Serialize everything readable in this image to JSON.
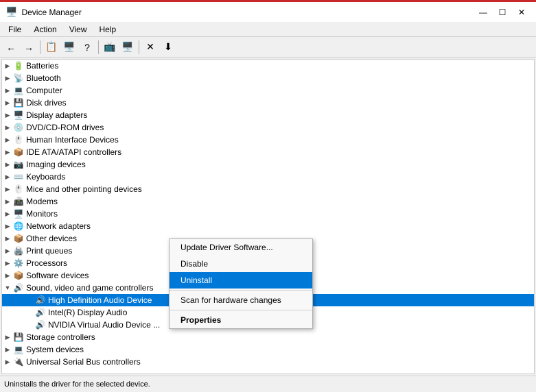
{
  "window": {
    "title": "Device Manager",
    "titleIcon": "🖥️"
  },
  "menu": {
    "items": [
      "File",
      "Action",
      "View",
      "Help"
    ]
  },
  "toolbar": {
    "buttons": [
      "←",
      "→",
      "📋",
      "🖥️",
      "?",
      "📺",
      "🖥️",
      "✕",
      "⬇"
    ]
  },
  "tree": {
    "items": [
      {
        "id": "batteries",
        "label": "Batteries",
        "indent": 1,
        "arrow": "▶",
        "icon": "🔋"
      },
      {
        "id": "bluetooth",
        "label": "Bluetooth",
        "indent": 1,
        "arrow": "▶",
        "icon": "📡"
      },
      {
        "id": "computer",
        "label": "Computer",
        "indent": 1,
        "arrow": "▶",
        "icon": "💻"
      },
      {
        "id": "diskdrives",
        "label": "Disk drives",
        "indent": 1,
        "arrow": "▶",
        "icon": "💾"
      },
      {
        "id": "displayadapters",
        "label": "Display adapters",
        "indent": 1,
        "arrow": "▶",
        "icon": "🖥️"
      },
      {
        "id": "dvdcdrom",
        "label": "DVD/CD-ROM drives",
        "indent": 1,
        "arrow": "▶",
        "icon": "💿"
      },
      {
        "id": "humaninterface",
        "label": "Human Interface Devices",
        "indent": 1,
        "arrow": "▶",
        "icon": "🖱️"
      },
      {
        "id": "ideata",
        "label": "IDE ATA/ATAPI controllers",
        "indent": 1,
        "arrow": "▶",
        "icon": "📦"
      },
      {
        "id": "imaging",
        "label": "Imaging devices",
        "indent": 1,
        "arrow": "▶",
        "icon": "📷"
      },
      {
        "id": "keyboards",
        "label": "Keyboards",
        "indent": 1,
        "arrow": "▶",
        "icon": "⌨️"
      },
      {
        "id": "mice",
        "label": "Mice and other pointing devices",
        "indent": 1,
        "arrow": "▶",
        "icon": "🖱️"
      },
      {
        "id": "modems",
        "label": "Modems",
        "indent": 1,
        "arrow": "▶",
        "icon": "📠"
      },
      {
        "id": "monitors",
        "label": "Monitors",
        "indent": 1,
        "arrow": "▶",
        "icon": "🖥️"
      },
      {
        "id": "networkadapters",
        "label": "Network adapters",
        "indent": 1,
        "arrow": "▶",
        "icon": "🌐"
      },
      {
        "id": "otherdevices",
        "label": "Other devices",
        "indent": 1,
        "arrow": "▶",
        "icon": "📦"
      },
      {
        "id": "printqueues",
        "label": "Print queues",
        "indent": 1,
        "arrow": "▶",
        "icon": "🖨️"
      },
      {
        "id": "processors",
        "label": "Processors",
        "indent": 1,
        "arrow": "▶",
        "icon": "⚙️"
      },
      {
        "id": "softwaredevices",
        "label": "Software devices",
        "indent": 1,
        "arrow": "▶",
        "icon": "📦"
      },
      {
        "id": "soundvideo",
        "label": "Sound, video and game controllers",
        "indent": 1,
        "arrow": "▼",
        "icon": "🔊",
        "expanded": true
      },
      {
        "id": "hd_audio",
        "label": "High Definition Audio Device",
        "indent": 2,
        "arrow": "",
        "icon": "🔊",
        "selected": true
      },
      {
        "id": "intel_display",
        "label": "Intel(R) Display Audio",
        "indent": 2,
        "arrow": "",
        "icon": "🔊"
      },
      {
        "id": "nvidia_audio",
        "label": "NVIDIA Virtual Audio Device ...",
        "indent": 2,
        "arrow": "",
        "icon": "🔊"
      },
      {
        "id": "storagecontrollers",
        "label": "Storage controllers",
        "indent": 1,
        "arrow": "▶",
        "icon": "💾"
      },
      {
        "id": "systemdevices",
        "label": "System devices",
        "indent": 1,
        "arrow": "▶",
        "icon": "💻"
      },
      {
        "id": "universalserial",
        "label": "Universal Serial Bus controllers",
        "indent": 1,
        "arrow": "▶",
        "icon": "🔌"
      }
    ]
  },
  "contextMenu": {
    "items": [
      {
        "id": "update-driver",
        "label": "Update Driver Software...",
        "type": "normal"
      },
      {
        "id": "disable",
        "label": "Disable",
        "type": "normal"
      },
      {
        "id": "uninstall",
        "label": "Uninstall",
        "type": "active"
      },
      {
        "id": "sep1",
        "type": "separator"
      },
      {
        "id": "scan-hardware",
        "label": "Scan for hardware changes",
        "type": "normal"
      },
      {
        "id": "sep2",
        "type": "separator"
      },
      {
        "id": "properties",
        "label": "Properties",
        "type": "bold"
      }
    ]
  },
  "statusBar": {
    "text": "Uninstalls the driver for the selected device."
  }
}
